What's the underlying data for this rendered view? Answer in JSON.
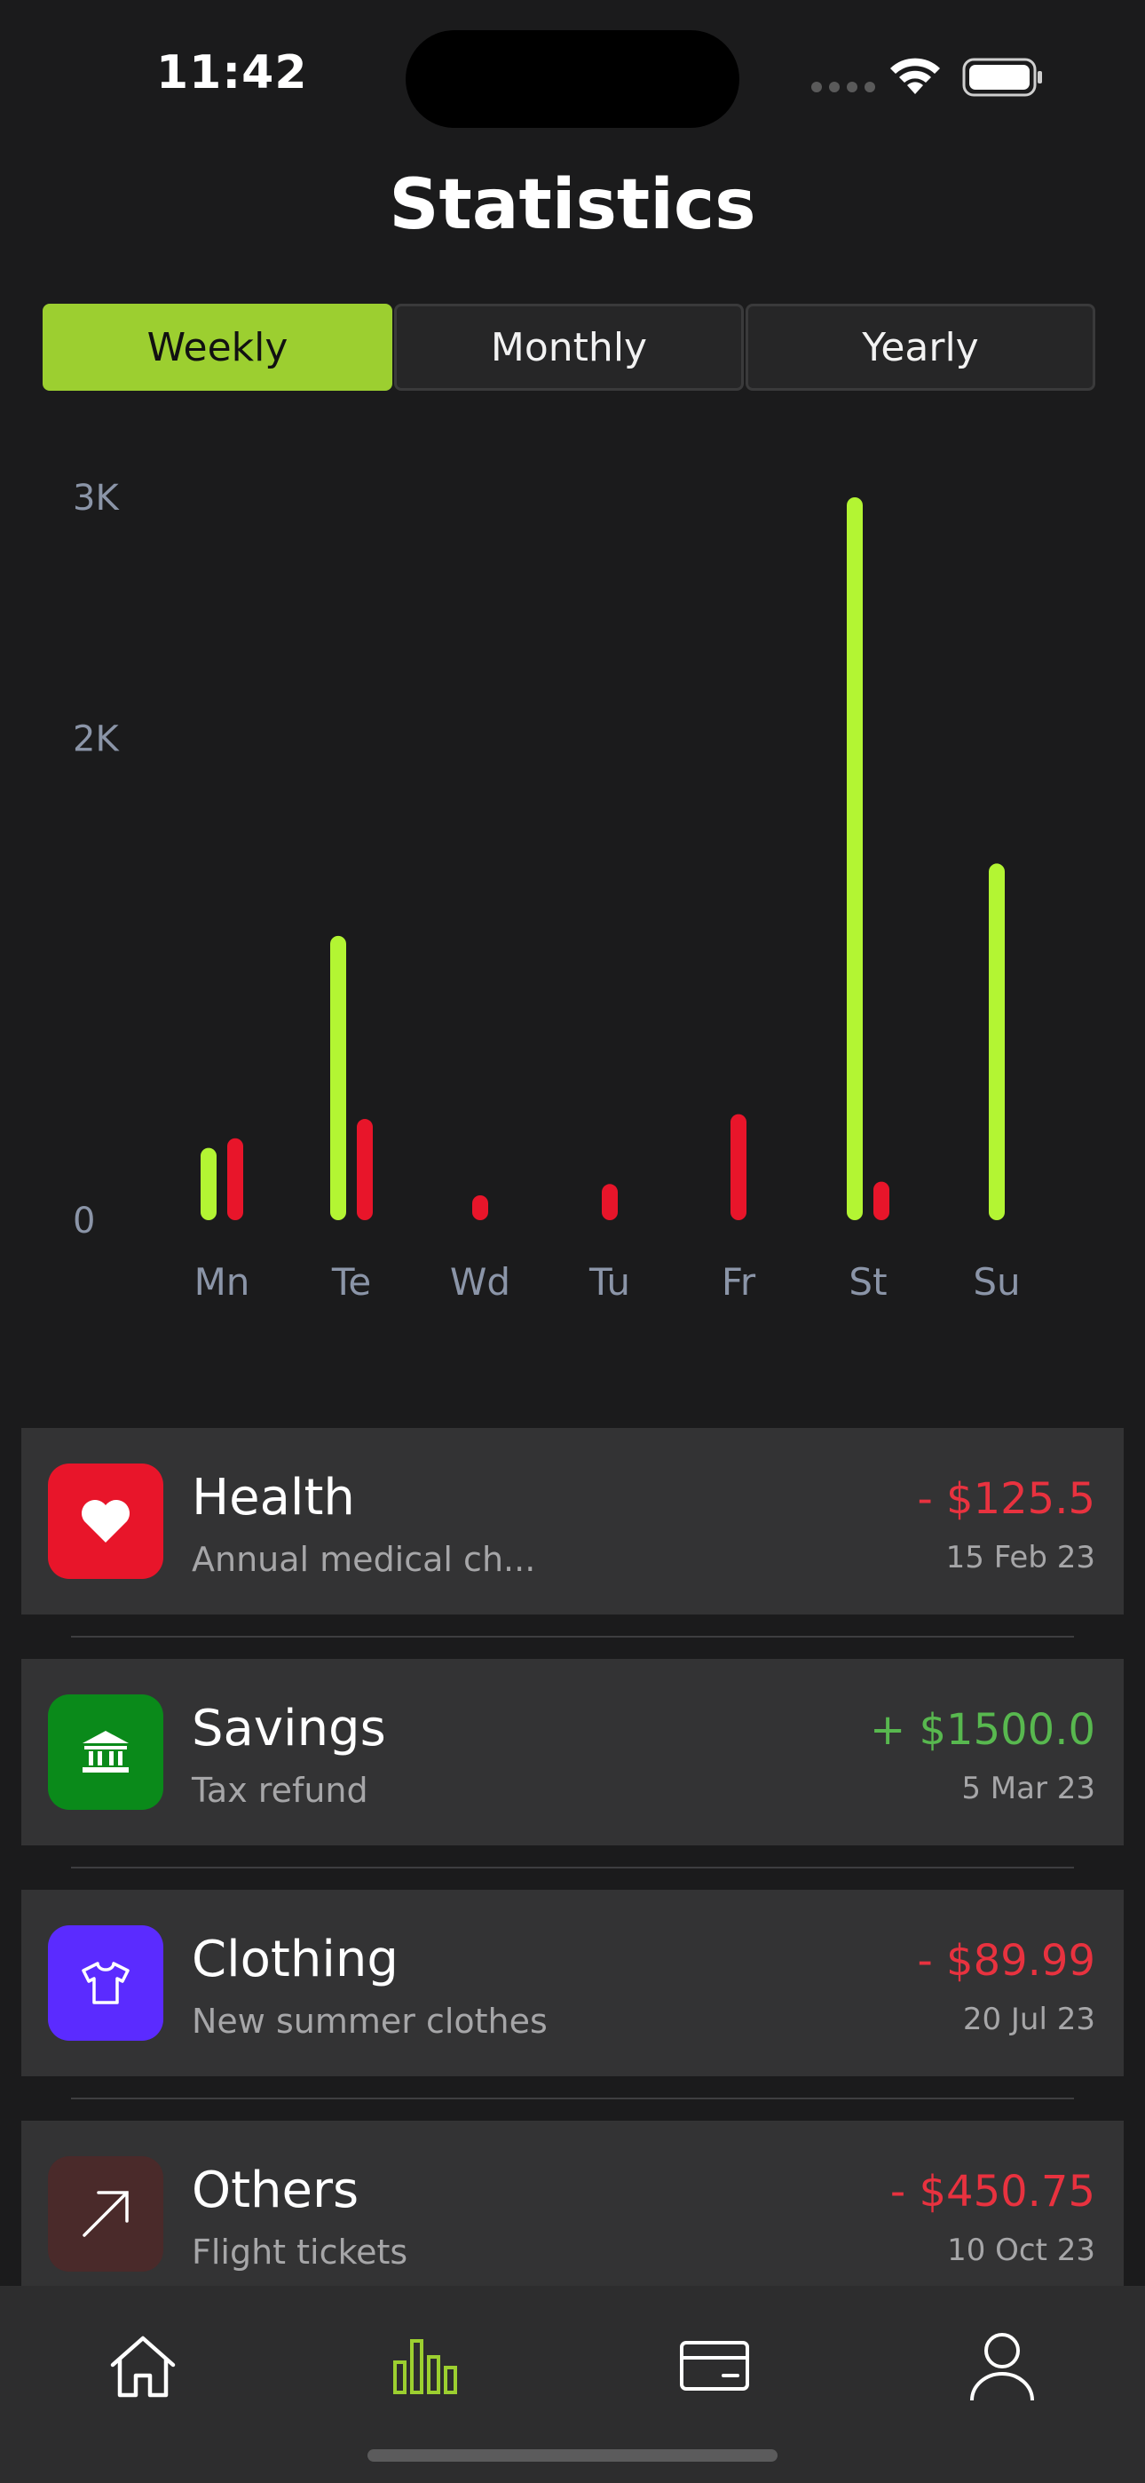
{
  "status_bar": {
    "time": "11:42"
  },
  "header": {
    "title": "Statistics"
  },
  "segments": [
    {
      "label": "Weekly",
      "active": true
    },
    {
      "label": "Monthly",
      "active": false
    },
    {
      "label": "Yearly",
      "active": false
    }
  ],
  "chart_data": {
    "type": "bar",
    "categories": [
      "Mn",
      "Te",
      "Wd",
      "Tu",
      "Fr",
      "St",
      "Su"
    ],
    "series": [
      {
        "color": "#b3f533",
        "values": [
          300,
          1180,
          0,
          0,
          0,
          3000,
          1480
        ]
      },
      {
        "color": "#e8152a",
        "values": [
          340,
          420,
          100,
          150,
          440,
          160,
          0
        ]
      }
    ],
    "yticks": [
      "0",
      "2K",
      "3K"
    ],
    "ytick_values": [
      0,
      2000,
      3000
    ],
    "ylim": [
      0,
      3000
    ],
    "grid": false
  },
  "transactions": [
    {
      "title": "Health",
      "subtitle": "Annual medical ch...",
      "amount": "- $125.5",
      "date": "15 Feb 23",
      "amount_color": "#e8323f",
      "icon": "heart-icon",
      "icon_bg": "#e8152a"
    },
    {
      "title": "Savings",
      "subtitle": "Tax refund",
      "amount": "+ $1500.0",
      "date": "5 Mar 23",
      "amount_color": "#58b84f",
      "icon": "bank-icon",
      "icon_bg": "#0a8a1a"
    },
    {
      "title": "Clothing",
      "subtitle": "New summer clothes",
      "amount": "- $89.99",
      "date": "20 Jul 23",
      "amount_color": "#e8323f",
      "icon": "tshirt-icon",
      "icon_bg": "#5b2bff"
    },
    {
      "title": "Others",
      "subtitle": "Flight tickets",
      "amount": "- $450.75",
      "date": "10 Oct 23",
      "amount_color": "#e8323f",
      "icon": "arrow-up-right-icon",
      "icon_bg": "#4a2a2a"
    }
  ],
  "tabbar": {
    "items": [
      {
        "icon": "home-icon",
        "active": false
      },
      {
        "icon": "chart-icon",
        "active": true
      },
      {
        "icon": "card-icon",
        "active": false
      },
      {
        "icon": "profile-icon",
        "active": false
      }
    ],
    "active_color": "#9ccf30"
  }
}
